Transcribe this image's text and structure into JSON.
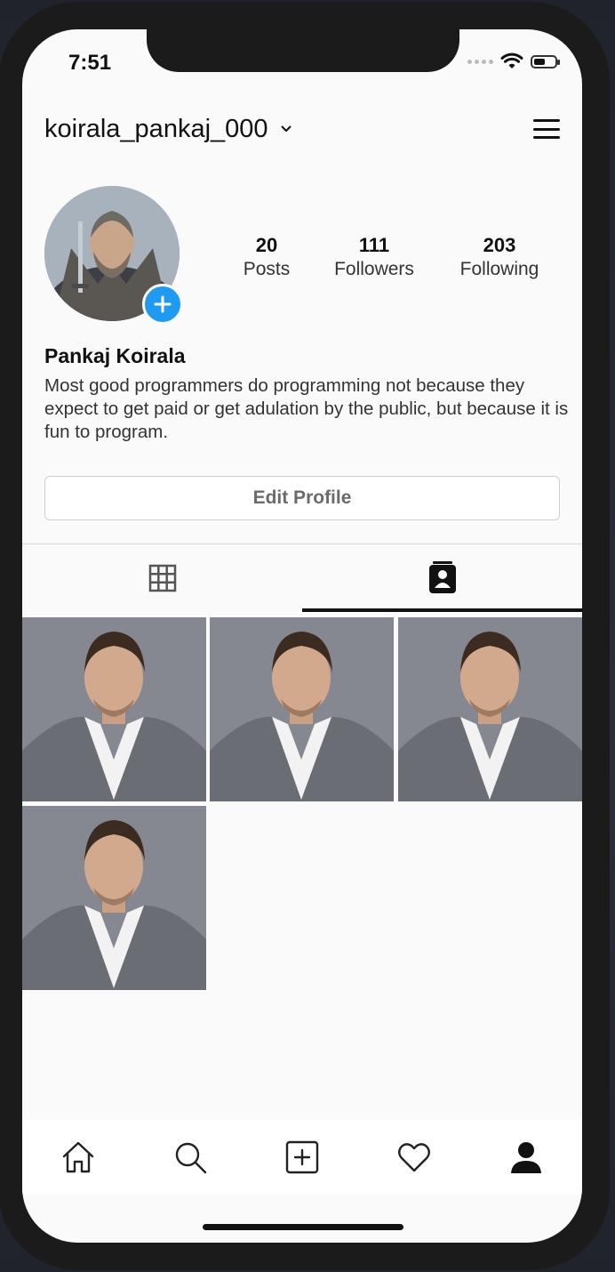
{
  "status_bar": {
    "time": "7:51"
  },
  "header": {
    "username": "koirala_pankaj_000"
  },
  "profile": {
    "stats": [
      {
        "value": "20",
        "label": "Posts"
      },
      {
        "value": "111",
        "label": "Followers"
      },
      {
        "value": "203",
        "label": "Following"
      }
    ],
    "display_name": "Pankaj Koirala",
    "bio": "Most good programmers do programming not because they expect to get paid or get adulation by the public, but because it is fun to program.",
    "edit_button_label": "Edit Profile"
  },
  "tabs": {
    "active_index": 1,
    "icons": [
      "grid-icon",
      "tagged-icon"
    ]
  },
  "photo_count": 4,
  "tabbar": {
    "icons": [
      "home-icon",
      "search-icon",
      "new-post-icon",
      "heart-icon",
      "profile-icon"
    ],
    "active": "profile-icon"
  },
  "colors": {
    "accent": "#1e9bf0",
    "background": "#fafafa",
    "text": "#111111"
  }
}
